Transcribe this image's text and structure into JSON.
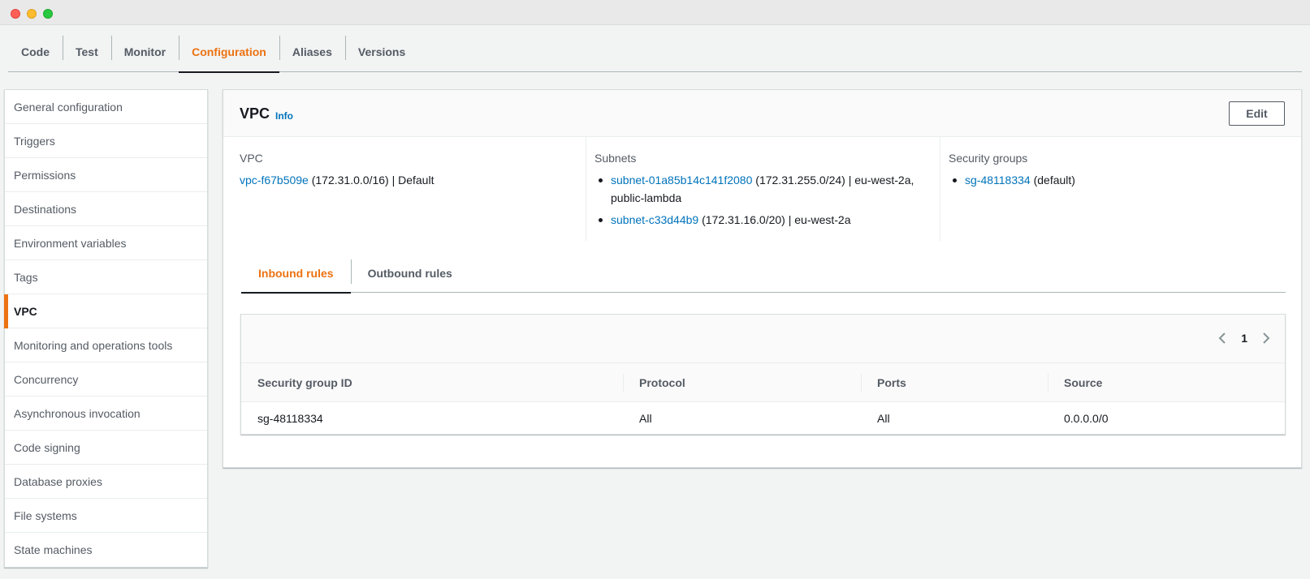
{
  "tabs": [
    {
      "label": "Code",
      "active": false
    },
    {
      "label": "Test",
      "active": false
    },
    {
      "label": "Monitor",
      "active": false
    },
    {
      "label": "Configuration",
      "active": true
    },
    {
      "label": "Aliases",
      "active": false
    },
    {
      "label": "Versions",
      "active": false
    }
  ],
  "sidebar": {
    "items": [
      {
        "label": "General configuration"
      },
      {
        "label": "Triggers"
      },
      {
        "label": "Permissions"
      },
      {
        "label": "Destinations"
      },
      {
        "label": "Environment variables"
      },
      {
        "label": "Tags"
      },
      {
        "label": "VPC",
        "active": true
      },
      {
        "label": "Monitoring and operations tools"
      },
      {
        "label": "Concurrency"
      },
      {
        "label": "Asynchronous invocation"
      },
      {
        "label": "Code signing"
      },
      {
        "label": "Database proxies"
      },
      {
        "label": "File systems"
      },
      {
        "label": "State machines"
      }
    ]
  },
  "panel": {
    "title": "VPC",
    "info_label": "Info",
    "edit_label": "Edit",
    "vpc": {
      "label": "VPC",
      "id": "vpc-f67b509e",
      "detail": " (172.31.0.0/16) | Default"
    },
    "subnets": {
      "label": "Subnets",
      "items": [
        {
          "id": "subnet-01a85b14c141f2080",
          "detail": " (172.31.255.0/24) | eu-west-2a,",
          "detail2": "public-lambda"
        },
        {
          "id": "subnet-c33d44b9",
          "detail": " (172.31.16.0/20) | eu-west-2a"
        }
      ]
    },
    "security_groups": {
      "label": "Security groups",
      "items": [
        {
          "id": "sg-48118334",
          "detail": " (default)"
        }
      ]
    },
    "rule_tabs": [
      {
        "label": "Inbound rules",
        "active": true
      },
      {
        "label": "Outbound rules",
        "active": false
      }
    ],
    "table": {
      "page": "1",
      "columns": [
        "Security group ID",
        "Protocol",
        "Ports",
        "Source"
      ],
      "rows": [
        [
          "sg-48118334",
          "All",
          "All",
          "0.0.0.0/0"
        ]
      ]
    }
  },
  "colors": {
    "accent": "#ec7211",
    "link": "#0073bb",
    "text": "#16191f",
    "muted": "#545b64"
  },
  "icons": [
    "chevron-left-icon",
    "chevron-right-icon"
  ]
}
